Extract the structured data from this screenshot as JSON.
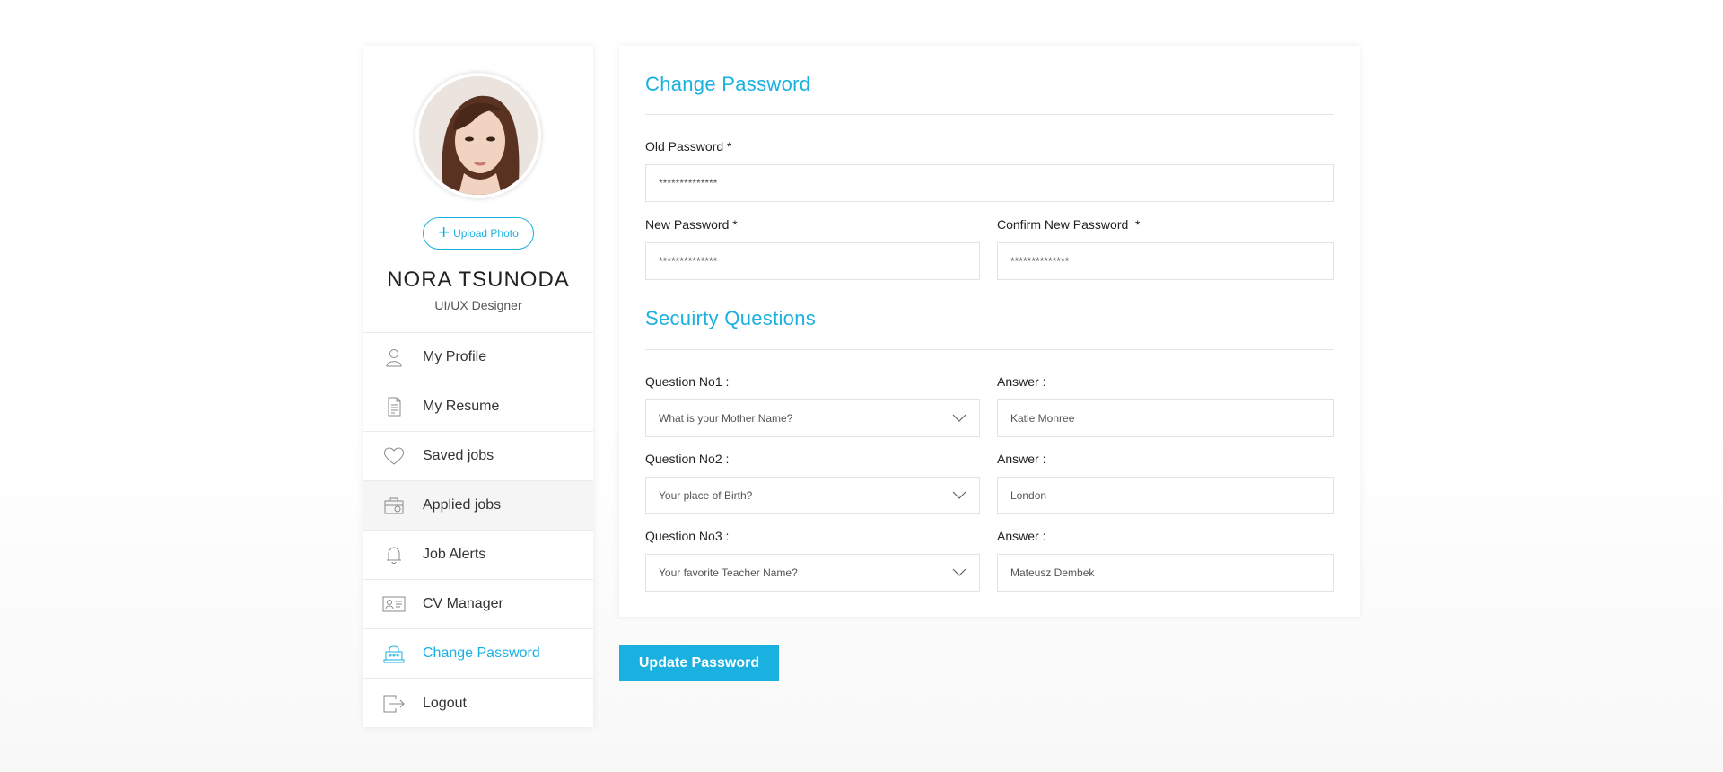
{
  "profile": {
    "upload_label": "Upload Photo",
    "name": "NORA TSUNODA",
    "role": "UI/UX Designer"
  },
  "menu": [
    {
      "label": "My Profile",
      "icon": "user-icon"
    },
    {
      "label": "My Resume",
      "icon": "resume-icon"
    },
    {
      "label": "Saved jobs",
      "icon": "heart-icon"
    },
    {
      "label": "Applied jobs",
      "icon": "briefcase-icon"
    },
    {
      "label": "Job Alerts",
      "icon": "bell-icon"
    },
    {
      "label": "CV Manager",
      "icon": "id-card-icon"
    },
    {
      "label": "Change Password",
      "icon": "lock-icon"
    },
    {
      "label": "Logout",
      "icon": "logout-icon"
    }
  ],
  "change_password": {
    "title": "Change Password",
    "old_label": "Old Password *",
    "old_value": "**************",
    "new_label": "New Password *",
    "new_value": "**************",
    "confirm_label": "Confirm New Password  *",
    "confirm_value": "**************"
  },
  "security": {
    "title": "Secuirty Questions",
    "questions": [
      {
        "label": "Question No1 :",
        "question": "What is your Mother Name?",
        "answer_label": "Answer :",
        "answer": "Katie Monree"
      },
      {
        "label": "Question No2 :",
        "question": "Your place of Birth?",
        "answer_label": "Answer :",
        "answer": "London"
      },
      {
        "label": "Question No3 :",
        "question": "Your favorite Teacher Name?",
        "answer_label": "Answer :",
        "answer": "Mateusz Dembek"
      }
    ]
  },
  "submit_label": "Update Password",
  "colors": {
    "accent": "#1ab0e0",
    "hover_row": "#f5f5f5",
    "text": "#333333"
  }
}
